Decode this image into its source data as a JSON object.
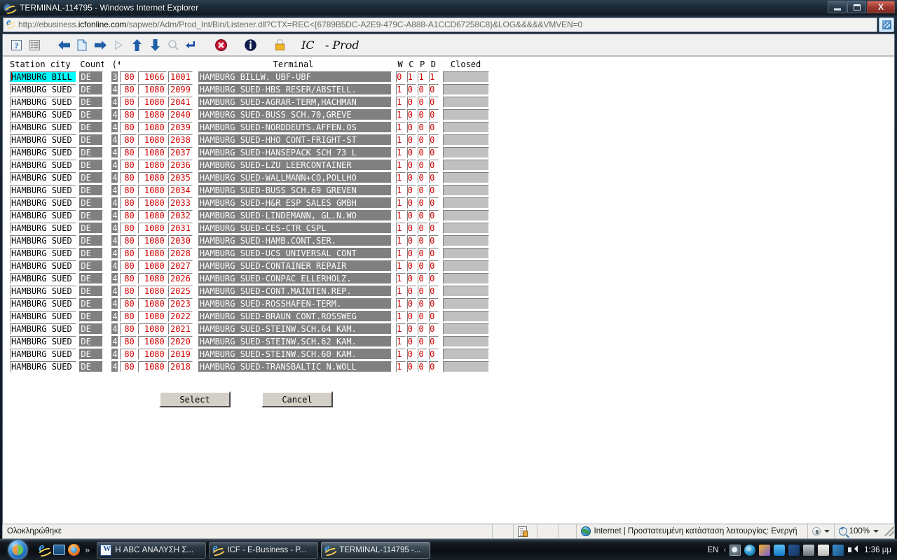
{
  "window": {
    "title": "TERMINAL-114795 - Windows Internet Explorer",
    "minimize_label": "Minimize",
    "maximize_label": "Maximize",
    "close_label": "X"
  },
  "address_bar": {
    "url_prefix": "http://ebusiness.",
    "url_domain": "icfonline.com",
    "url_suffix": "/sapweb/Adm/Prod_Int/Bin/Listener.dll?CTX=REC<{6789B5DC-A2E9-479C-A888-A1CCD67258C8}&LOG&&&&&VMVEN=0",
    "go_label": "Go"
  },
  "sap_toolbar": {
    "icons": [
      "help-icon",
      "list-icon",
      "back-arrow-icon",
      "new-page-icon",
      "forward-arrow-icon",
      "play-icon-disabled",
      "up-arrow-icon",
      "down-arrow-icon",
      "search-icon-disabled",
      "enter-icon",
      "cancel-icon",
      "info-icon",
      "lock-icon"
    ],
    "app_label": "IC   - Prod"
  },
  "grid": {
    "headers": {
      "station_city": "Station city",
      "country": "Country",
      "star": "(*)",
      "terminal": "Terminal",
      "w": "W",
      "c": "C",
      "p": "P",
      "d": "D",
      "closed": "Closed"
    },
    "rows": [
      {
        "city": "HAMBURG BILL",
        "country": "DE",
        "star": "3",
        "n80": "80",
        "n1080": "1066",
        "code": "1001",
        "terminal": "HAMBURG BILLW. UBF-UBF",
        "w": "0",
        "c": "1",
        "p": "1",
        "d": "1",
        "closed": "",
        "selected": true
      },
      {
        "city": "HAMBURG SUED",
        "country": "DE",
        "star": "4",
        "n80": "80",
        "n1080": "1080",
        "code": "2099",
        "terminal": "HAMBURG SUED-HBS RESER/ABSTELL.",
        "w": "1",
        "c": "0",
        "p": "0",
        "d": "0",
        "closed": "",
        "selected": false
      },
      {
        "city": "HAMBURG SUED",
        "country": "DE",
        "star": "4",
        "n80": "80",
        "n1080": "1080",
        "code": "2041",
        "terminal": "HAMBURG SUED-AGRAR-TERM,HACHMAN",
        "w": "1",
        "c": "0",
        "p": "0",
        "d": "0",
        "closed": "",
        "selected": false
      },
      {
        "city": "HAMBURG SUED",
        "country": "DE",
        "star": "4",
        "n80": "80",
        "n1080": "1080",
        "code": "2040",
        "terminal": "HAMBURG SUED-BUSS SCH.70,GREVE",
        "w": "1",
        "c": "0",
        "p": "0",
        "d": "0",
        "closed": "",
        "selected": false
      },
      {
        "city": "HAMBURG SUED",
        "country": "DE",
        "star": "4",
        "n80": "80",
        "n1080": "1080",
        "code": "2039",
        "terminal": "HAMBURG SUED-NORDDEUTS.AFFEN.OS",
        "w": "1",
        "c": "0",
        "p": "0",
        "d": "0",
        "closed": "",
        "selected": false
      },
      {
        "city": "HAMBURG SUED",
        "country": "DE",
        "star": "4",
        "n80": "80",
        "n1080": "1080",
        "code": "2038",
        "terminal": "HAMBURG SUED-HHO CONT-FRIGHT-ST",
        "w": "1",
        "c": "0",
        "p": "0",
        "d": "0",
        "closed": "",
        "selected": false
      },
      {
        "city": "HAMBURG SUED",
        "country": "DE",
        "star": "4",
        "n80": "80",
        "n1080": "1080",
        "code": "2037",
        "terminal": "HAMBURG SUED-HANSEPACK SCH 73 L",
        "w": "1",
        "c": "0",
        "p": "0",
        "d": "0",
        "closed": "",
        "selected": false
      },
      {
        "city": "HAMBURG SUED",
        "country": "DE",
        "star": "4",
        "n80": "80",
        "n1080": "1080",
        "code": "2036",
        "terminal": "HAMBURG SUED-LZU LEERCONTAINER",
        "w": "1",
        "c": "0",
        "p": "0",
        "d": "0",
        "closed": "",
        "selected": false
      },
      {
        "city": "HAMBURG SUED",
        "country": "DE",
        "star": "4",
        "n80": "80",
        "n1080": "1080",
        "code": "2035",
        "terminal": "HAMBURG SUED-WALLMANN+CO,POLLHO",
        "w": "1",
        "c": "0",
        "p": "0",
        "d": "0",
        "closed": "",
        "selected": false
      },
      {
        "city": "HAMBURG SUED",
        "country": "DE",
        "star": "4",
        "n80": "80",
        "n1080": "1080",
        "code": "2034",
        "terminal": "HAMBURG SUED-BUSS SCH.69 GREVEN",
        "w": "1",
        "c": "0",
        "p": "0",
        "d": "0",
        "closed": "",
        "selected": false
      },
      {
        "city": "HAMBURG SUED",
        "country": "DE",
        "star": "4",
        "n80": "80",
        "n1080": "1080",
        "code": "2033",
        "terminal": "HAMBURG SUED-H&R ESP SALES GMBH",
        "w": "1",
        "c": "0",
        "p": "0",
        "d": "0",
        "closed": "",
        "selected": false
      },
      {
        "city": "HAMBURG SUED",
        "country": "DE",
        "star": "4",
        "n80": "80",
        "n1080": "1080",
        "code": "2032",
        "terminal": "HAMBURG SUED-LINDEMANN, GL.N.WO",
        "w": "1",
        "c": "0",
        "p": "0",
        "d": "0",
        "closed": "",
        "selected": false
      },
      {
        "city": "HAMBURG SUED",
        "country": "DE",
        "star": "4",
        "n80": "80",
        "n1080": "1080",
        "code": "2031",
        "terminal": "HAMBURG SUED-CES-CTR CSPL",
        "w": "1",
        "c": "0",
        "p": "0",
        "d": "0",
        "closed": "",
        "selected": false
      },
      {
        "city": "HAMBURG SUED",
        "country": "DE",
        "star": "4",
        "n80": "80",
        "n1080": "1080",
        "code": "2030",
        "terminal": "HAMBURG SUED-HAMB.CONT.SER.",
        "w": "1",
        "c": "0",
        "p": "0",
        "d": "0",
        "closed": "",
        "selected": false
      },
      {
        "city": "HAMBURG SUED",
        "country": "DE",
        "star": "4",
        "n80": "80",
        "n1080": "1080",
        "code": "2028",
        "terminal": "HAMBURG SUED-UCS UNIVERSAL CONT",
        "w": "1",
        "c": "0",
        "p": "0",
        "d": "0",
        "closed": "",
        "selected": false
      },
      {
        "city": "HAMBURG SUED",
        "country": "DE",
        "star": "4",
        "n80": "80",
        "n1080": "1080",
        "code": "2027",
        "terminal": "HAMBURG SUED-CONTAINER REPAIR",
        "w": "1",
        "c": "0",
        "p": "0",
        "d": "0",
        "closed": "",
        "selected": false
      },
      {
        "city": "HAMBURG SUED",
        "country": "DE",
        "star": "4",
        "n80": "80",
        "n1080": "1080",
        "code": "2026",
        "terminal": "HAMBURG SUED-CONPAC ELLERHOLZ.",
        "w": "1",
        "c": "0",
        "p": "0",
        "d": "0",
        "closed": "",
        "selected": false
      },
      {
        "city": "HAMBURG SUED",
        "country": "DE",
        "star": "4",
        "n80": "80",
        "n1080": "1080",
        "code": "2025",
        "terminal": "HAMBURG SUED-CONT.MAINTEN.REP.",
        "w": "1",
        "c": "0",
        "p": "0",
        "d": "0",
        "closed": "",
        "selected": false
      },
      {
        "city": "HAMBURG SUED",
        "country": "DE",
        "star": "4",
        "n80": "80",
        "n1080": "1080",
        "code": "2023",
        "terminal": "HAMBURG SUED-ROSSHAFEN-TERM.",
        "w": "1",
        "c": "0",
        "p": "0",
        "d": "0",
        "closed": "",
        "selected": false
      },
      {
        "city": "HAMBURG SUED",
        "country": "DE",
        "star": "4",
        "n80": "80",
        "n1080": "1080",
        "code": "2022",
        "terminal": "HAMBURG SUED-BRAUN CONT.ROSSWEG",
        "w": "1",
        "c": "0",
        "p": "0",
        "d": "0",
        "closed": "",
        "selected": false
      },
      {
        "city": "HAMBURG SUED",
        "country": "DE",
        "star": "4",
        "n80": "80",
        "n1080": "1080",
        "code": "2021",
        "terminal": "HAMBURG SUED-STEINW.SCH.64 KAM.",
        "w": "1",
        "c": "0",
        "p": "0",
        "d": "0",
        "closed": "",
        "selected": false
      },
      {
        "city": "HAMBURG SUED",
        "country": "DE",
        "star": "4",
        "n80": "80",
        "n1080": "1080",
        "code": "2020",
        "terminal": "HAMBURG SUED-STEINW.SCH.62 KAM.",
        "w": "1",
        "c": "0",
        "p": "0",
        "d": "0",
        "closed": "",
        "selected": false
      },
      {
        "city": "HAMBURG SUED",
        "country": "DE",
        "star": "4",
        "n80": "80",
        "n1080": "1080",
        "code": "2019",
        "terminal": "HAMBURG SUED-STEINW.SCH.60 KAM.",
        "w": "1",
        "c": "0",
        "p": "0",
        "d": "0",
        "closed": "",
        "selected": false
      },
      {
        "city": "HAMBURG SUED",
        "country": "DE",
        "star": "4",
        "n80": "80",
        "n1080": "1080",
        "code": "2018",
        "terminal": "HAMBURG SUED-TRANSBALTIC N.WOLL",
        "w": "1",
        "c": "0",
        "p": "0",
        "d": "0",
        "closed": "",
        "selected": false
      }
    ]
  },
  "buttons": {
    "select": "Select",
    "cancel": "Cancel"
  },
  "status_bar": {
    "left_text": "Ολοκληρώθηκε",
    "zone_text": "Internet | Προστατευμένη κατάσταση λειτουργίας: Ενεργή",
    "zoom_level": "100%"
  },
  "taskbar": {
    "start_label": "Start",
    "quick_launch": [
      "internet-explorer-icon",
      "show-desktop-icon",
      "firefox-icon"
    ],
    "more_label": "»",
    "tasks": [
      {
        "label": "Η ABC ΑΝΑΛΥΣΗ Σ...",
        "icon": "word-document-icon",
        "active": false
      },
      {
        "label": "ICF - E-Business - P...",
        "icon": "internet-explorer-icon",
        "active": false
      },
      {
        "label": "TERMINAL-114795 -...",
        "icon": "internet-explorer-icon",
        "active": true
      }
    ],
    "language": "EN",
    "chevron": "‹",
    "clock": "1:36 μμ"
  },
  "colors": {
    "selection_cyan": "#00ffff",
    "field_red": "#d00000",
    "disabled_grey": "#808080",
    "closed_grey": "#c0c0c0"
  }
}
